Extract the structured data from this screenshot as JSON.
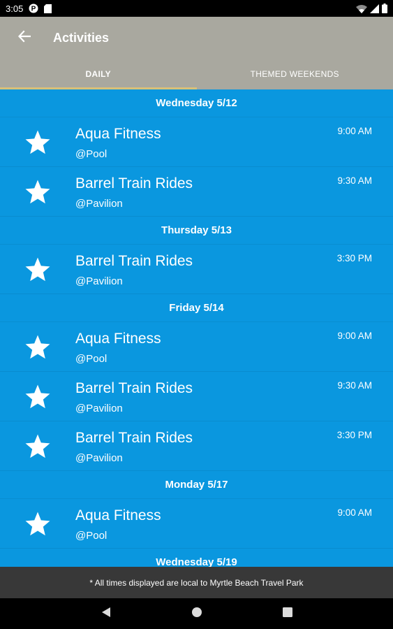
{
  "status_bar": {
    "time": "3:05",
    "left_icons": [
      "p-notification-icon",
      "sd-card-icon"
    ],
    "right_icons": [
      "wifi-icon",
      "signal-icon",
      "battery-icon"
    ]
  },
  "app_bar": {
    "title": "Activities",
    "back_icon": "arrow-back-icon",
    "background": "#a9a89f"
  },
  "tabs": [
    {
      "label": "DAILY",
      "active": true
    },
    {
      "label": "THEMED WEEKENDS",
      "active": false
    }
  ],
  "colors": {
    "list_background": "#0a97df",
    "tab_indicator": "#d9c178",
    "footer_background": "#383838"
  },
  "sections": [
    {
      "date": "Wednesday 5/12",
      "activities": [
        {
          "name": "Aqua Fitness",
          "location": "@Pool",
          "time": "9:00 AM",
          "icon": "star-icon"
        },
        {
          "name": "Barrel Train Rides",
          "location": "@Pavilion",
          "time": "9:30 AM",
          "icon": "star-icon"
        }
      ]
    },
    {
      "date": "Thursday 5/13",
      "activities": [
        {
          "name": "Barrel Train Rides",
          "location": "@Pavilion",
          "time": "3:30 PM",
          "icon": "star-icon"
        }
      ]
    },
    {
      "date": "Friday 5/14",
      "activities": [
        {
          "name": "Aqua Fitness",
          "location": "@Pool",
          "time": "9:00 AM",
          "icon": "star-icon"
        },
        {
          "name": "Barrel Train Rides",
          "location": "@Pavilion",
          "time": "9:30 AM",
          "icon": "star-icon"
        },
        {
          "name": "Barrel Train Rides",
          "location": "@Pavilion",
          "time": "3:30 PM",
          "icon": "star-icon"
        }
      ]
    },
    {
      "date": "Monday 5/17",
      "activities": [
        {
          "name": "Aqua Fitness",
          "location": "@Pool",
          "time": "9:00 AM",
          "icon": "star-icon"
        }
      ]
    },
    {
      "date": "Wednesday 5/19",
      "activities": []
    }
  ],
  "footer_note": "* All times displayed are local to Myrtle Beach Travel Park",
  "nav_bar": {
    "buttons": [
      "back-triangle-icon",
      "home-circle-icon",
      "recents-square-icon"
    ]
  }
}
